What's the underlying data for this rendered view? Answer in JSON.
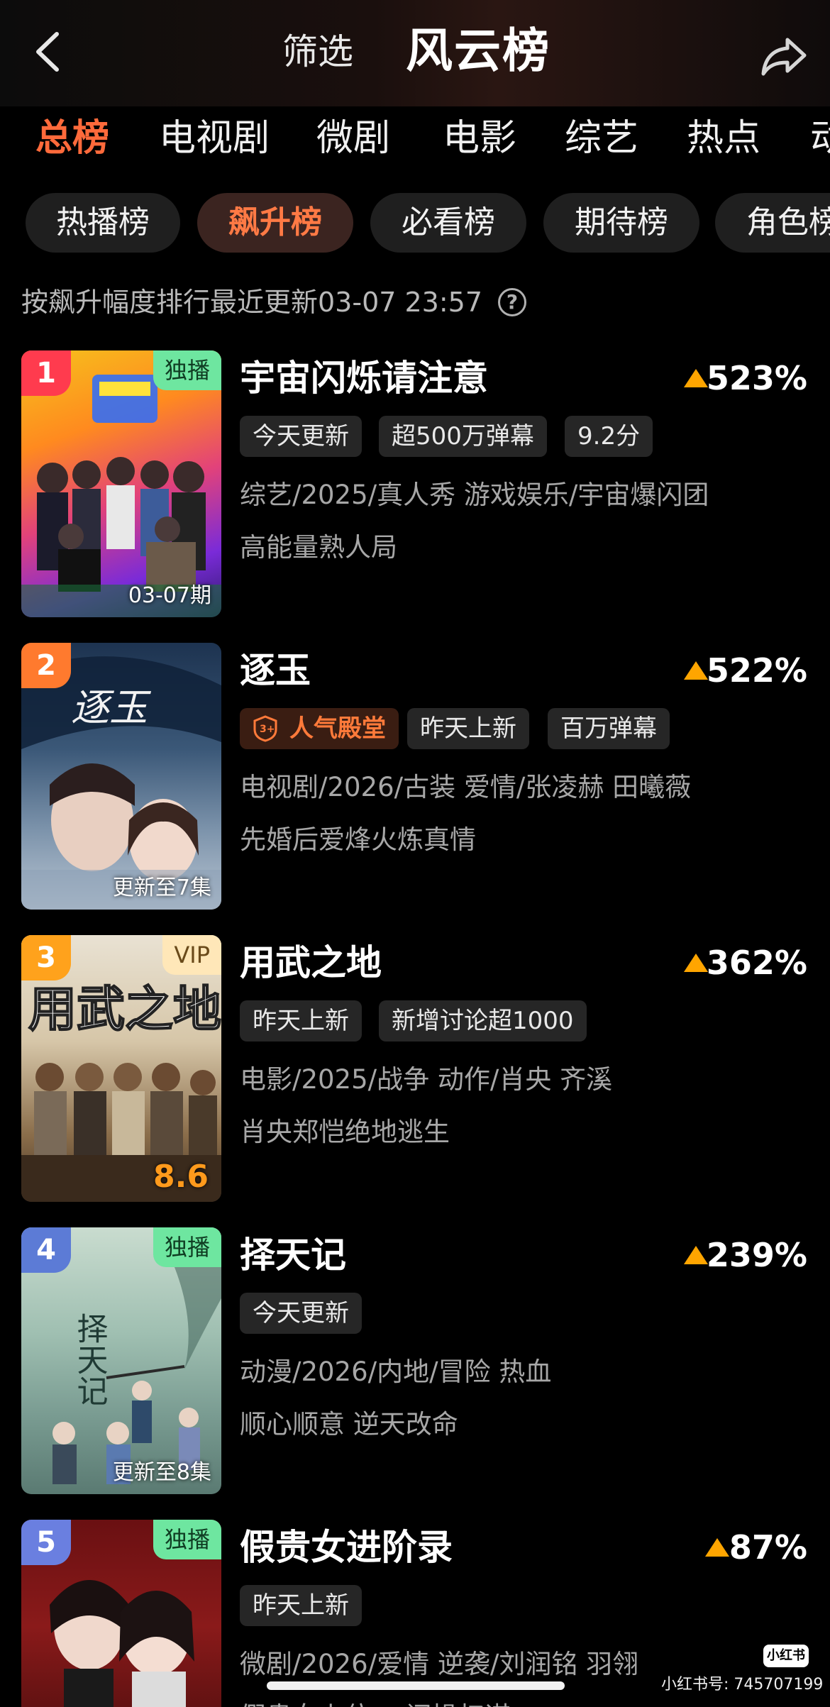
{
  "header": {
    "filter_label": "筛选",
    "title": "风云榜"
  },
  "category_tabs": [
    "总榜",
    "电视剧",
    "微剧",
    "电影",
    "综艺",
    "热点",
    "动"
  ],
  "sub_tabs": [
    "热播榜",
    "飙升榜",
    "必看榜",
    "期待榜",
    "角色榜"
  ],
  "info": {
    "text": "按飙升幅度排行最近更新03-07 23:57",
    "help_glyph": "?"
  },
  "colors": {
    "accent": "#ff6a3b",
    "rise_arrow": "#ffa500",
    "exclusive_badge": "#6ee6a0"
  },
  "items": [
    {
      "rank": "1",
      "corner_badge": "独播",
      "poster_caption": "03-07期",
      "title": "宇宙闪烁请注意",
      "rise": "523%",
      "tags": [
        "今天更新",
        "超500万弹幕",
        "9.2分"
      ],
      "meta": "综艺/2025/真人秀 游戏娱乐/宇宙爆闪团",
      "slogan": "高能量熟人局"
    },
    {
      "rank": "2",
      "poster_caption": "更新至7集",
      "title": "逐玉",
      "rise": "522%",
      "honor_tag": "人气殿堂",
      "tags": [
        "昨天上新",
        "百万弹幕"
      ],
      "meta": "电视剧/2026/古装 爱情/张凌赫 田曦薇",
      "slogan": "先婚后爱烽火炼真情"
    },
    {
      "rank": "3",
      "corner_badge": "VIP",
      "poster_score": "8.6",
      "title": "用武之地",
      "rise": "362%",
      "tags": [
        "昨天上新",
        "新增讨论超1000"
      ],
      "meta": "电影/2025/战争 动作/肖央 齐溪",
      "slogan": "肖央郑恺绝地逃生"
    },
    {
      "rank": "4",
      "corner_badge": "独播",
      "poster_caption": "更新至8集",
      "title": "择天记",
      "rise": "239%",
      "tags": [
        "今天更新"
      ],
      "meta": "动漫/2026/内地/冒险 热血",
      "slogan": "顺心顺意 逆天改命"
    },
    {
      "rank": "5",
      "corner_badge": "独播",
      "title": "假贵女进阶录",
      "rise": "87%",
      "tags": [
        "昨天上新"
      ],
      "meta": "微剧/2026/爱情 逆袭/刘润铭 羽翎",
      "slogan": "假贵女上位 一问操权谋"
    }
  ],
  "watermark": {
    "logo": "小红书",
    "text": "小红书号: 745707199"
  }
}
